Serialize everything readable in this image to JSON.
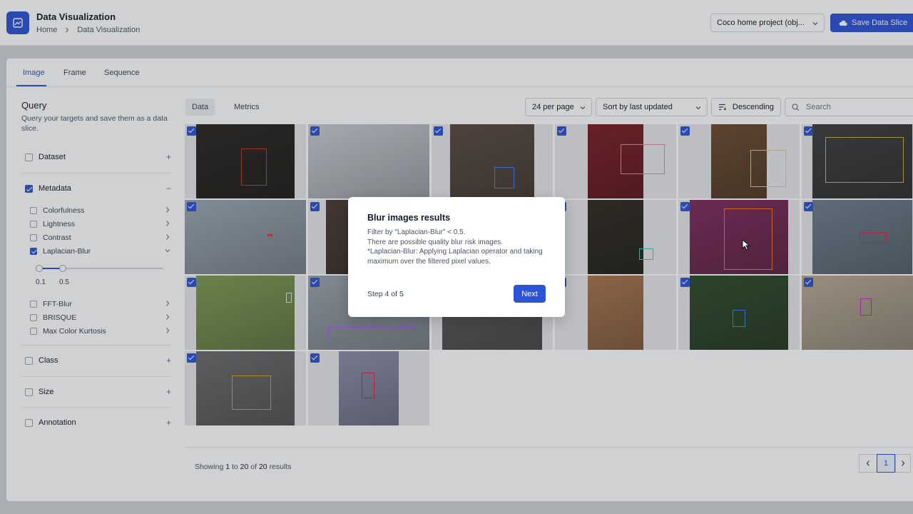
{
  "header": {
    "title": "Data Visualization",
    "breadcrumb": [
      "Home",
      "Data Visualization"
    ],
    "project_select": "Coco home project (obj...",
    "save_button": "Save Data Slice"
  },
  "tabs": [
    "Image",
    "Frame",
    "Sequence"
  ],
  "active_tab": "Image",
  "query": {
    "title": "Query",
    "description": "Query your targets and save them as a data slice.",
    "sections": [
      {
        "label": "Dataset",
        "checked": false,
        "control": "+"
      },
      {
        "label": "Metadata",
        "checked": true,
        "control": "−"
      },
      {
        "label": "Class",
        "checked": false,
        "control": "+"
      },
      {
        "label": "Size",
        "checked": false,
        "control": "+"
      },
      {
        "label": "Annotation",
        "checked": false,
        "control": "+"
      }
    ],
    "metadata_items": [
      {
        "label": "Colorfulness",
        "checked": false
      },
      {
        "label": "Lightness",
        "checked": false
      },
      {
        "label": "Contrast",
        "checked": false
      },
      {
        "label": "Laplacian-Blur",
        "checked": true
      },
      {
        "label": "FFT-Blur",
        "checked": false
      },
      {
        "label": "BRISQUE",
        "checked": false
      },
      {
        "label": "Max Color Kurtosis",
        "checked": false
      }
    ],
    "slider": {
      "min_label": "0.1",
      "max_label": "0.5"
    }
  },
  "toolbar": {
    "view_tabs": [
      "Data",
      "Metrics"
    ],
    "per_page": "24 per page",
    "sort": "Sort by last updated",
    "order": "Descending",
    "search_placeholder": "Search"
  },
  "grid": {
    "tiles": [
      {
        "bg": "#2a2622",
        "bbox_color": "#c0392b"
      },
      {
        "bg": "#c9ccd2",
        "bbox_color": ""
      },
      {
        "bg": "#5a4a40",
        "bbox_color": "#3b82f6"
      },
      {
        "bg": "#7a1e26",
        "bbox_color": "#d98d8d"
      },
      {
        "bg": "#6b4a30",
        "bbox_color": "#d7c9a5"
      },
      {
        "bg": "#3d3d3d",
        "bbox_color": "#c5b347"
      },
      {
        "bg": "#9aa7b3",
        "bbox_color": "#dc2626"
      },
      {
        "bg": "#4a3a32",
        "bbox_color": ""
      },
      {
        "bg": "#555555",
        "bbox_color": ""
      },
      {
        "bg": "#2f2a20",
        "bbox_color": "#2dd4bf"
      },
      {
        "bg": "#7d2b5a",
        "bbox_color": "#f97316"
      },
      {
        "bg": "#6e7d8c",
        "bbox_color": "#e11d48"
      },
      {
        "bg": "#7d9a52",
        "bbox_color": "#e5e7eb"
      },
      {
        "bg": "#9aa3ad",
        "bbox_color": "#a855f7"
      },
      {
        "bg": "#5c5c5c",
        "bbox_color": ""
      },
      {
        "bg": "#a8744c",
        "bbox_color": ""
      },
      {
        "bg": "#2f4a2a",
        "bbox_color": "#3b82f6"
      },
      {
        "bg": "#b8aa96",
        "bbox_color": "#c026d3"
      },
      {
        "bg": "#6b6b6b",
        "bbox_color": "#d4a017"
      },
      {
        "bg": "#8c8fa8",
        "bbox_color": "#e11d48"
      }
    ]
  },
  "results": {
    "prefix": "Showing",
    "from": "1",
    "to_word": "to",
    "to": "20",
    "of_word": "of",
    "total": "20",
    "suffix": "results"
  },
  "pagination": {
    "current": "1"
  },
  "dialog": {
    "title": "Blur images results",
    "lines": [
      "Filter by \"Laplacian-Blur\" < 0.5.",
      "There are possible quality blur risk images.",
      "*Laplacian-Blur: Applying Laplacian operator and taking maximum over the filtered pixel values."
    ],
    "step": "Step 4 of 5",
    "next": "Next"
  }
}
